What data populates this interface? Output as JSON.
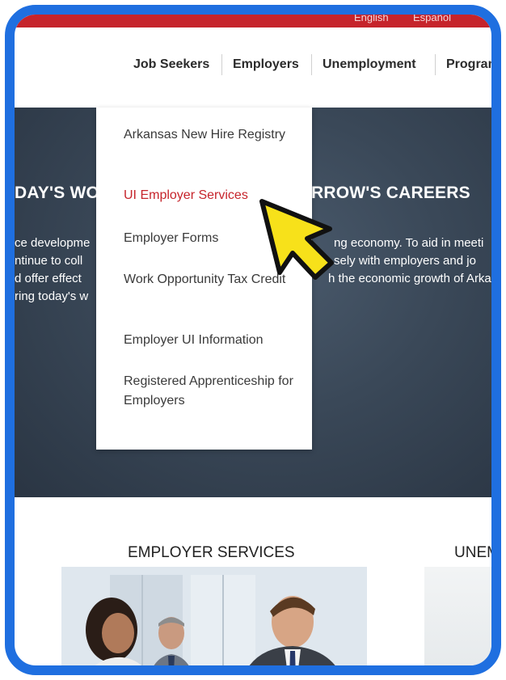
{
  "header": {
    "languages": [
      "English",
      "Español"
    ]
  },
  "nav": {
    "items": [
      "Job Seekers",
      "Employers",
      "Unemployment",
      "Programs"
    ]
  },
  "hero": {
    "heading_left": "DAY'S WO",
    "heading_right": "RROW'S CAREERS",
    "lines_left": [
      "ce developme",
      "ntinue to coll",
      "d offer effect",
      "ring today's w"
    ],
    "lines_right": [
      "ng economy. To aid in meeti",
      "sely with employers and jo",
      "h the economic growth of Arka"
    ]
  },
  "dropdown": {
    "items": [
      "Arkansas New Hire Registry",
      "UI Employer Services",
      "Employer Forms",
      "Work Opportunity Tax Credit",
      "Employer UI Information",
      "Registered Apprenticeship for Employers"
    ],
    "active_index": 1
  },
  "sections": {
    "employer_services": "EMPLOYER SERVICES",
    "unemployment_partial": "UNEM"
  },
  "colors": {
    "frame_border": "#1f6fe0",
    "brand_red": "#c6242b",
    "cursor_fill": "#f7e11a"
  },
  "icons": {
    "pointer": "arrow-cursor-icon"
  }
}
